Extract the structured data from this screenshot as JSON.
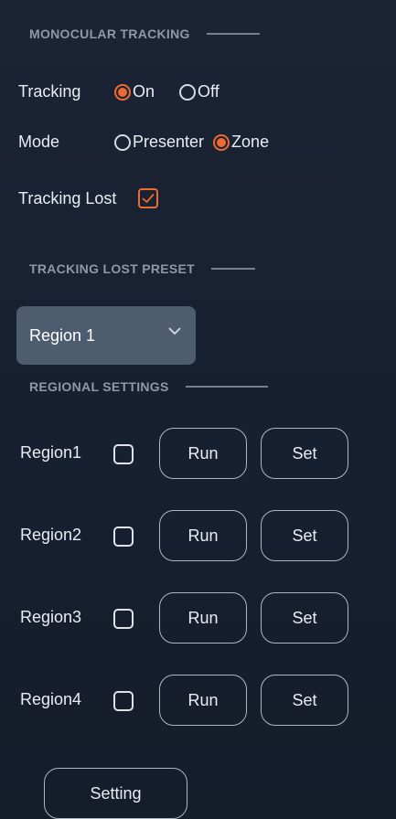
{
  "monocular": {
    "header": "MONOCULAR TRACKING",
    "tracking": {
      "label": "Tracking",
      "on_label": "On",
      "off_label": "Off",
      "selected": "On"
    },
    "mode": {
      "label": "Mode",
      "presenter_label": "Presenter",
      "zone_label": "Zone",
      "selected": "Zone"
    },
    "tracking_lost": {
      "label": "Tracking Lost",
      "checked": true
    }
  },
  "lost_preset": {
    "header": "TRACKING LOST PRESET",
    "selected": "Region 1"
  },
  "regional": {
    "header": "REGIONAL SETTINGS",
    "regions": [
      {
        "label": "Region1",
        "checked": false,
        "run_label": "Run",
        "set_label": "Set"
      },
      {
        "label": "Region2",
        "checked": false,
        "run_label": "Run",
        "set_label": "Set"
      },
      {
        "label": "Region3",
        "checked": false,
        "run_label": "Run",
        "set_label": "Set"
      },
      {
        "label": "Region4",
        "checked": false,
        "run_label": "Run",
        "set_label": "Set"
      }
    ]
  },
  "setting_button": {
    "label": "Setting"
  },
  "colors": {
    "accent": "#ef6a33",
    "background": "#1b2434",
    "dropdown_bg": "#4e5c6f",
    "header_text": "#8f98a6"
  },
  "icons": {
    "dropdown": "chevron-down-icon",
    "check": "checkmark-icon"
  }
}
